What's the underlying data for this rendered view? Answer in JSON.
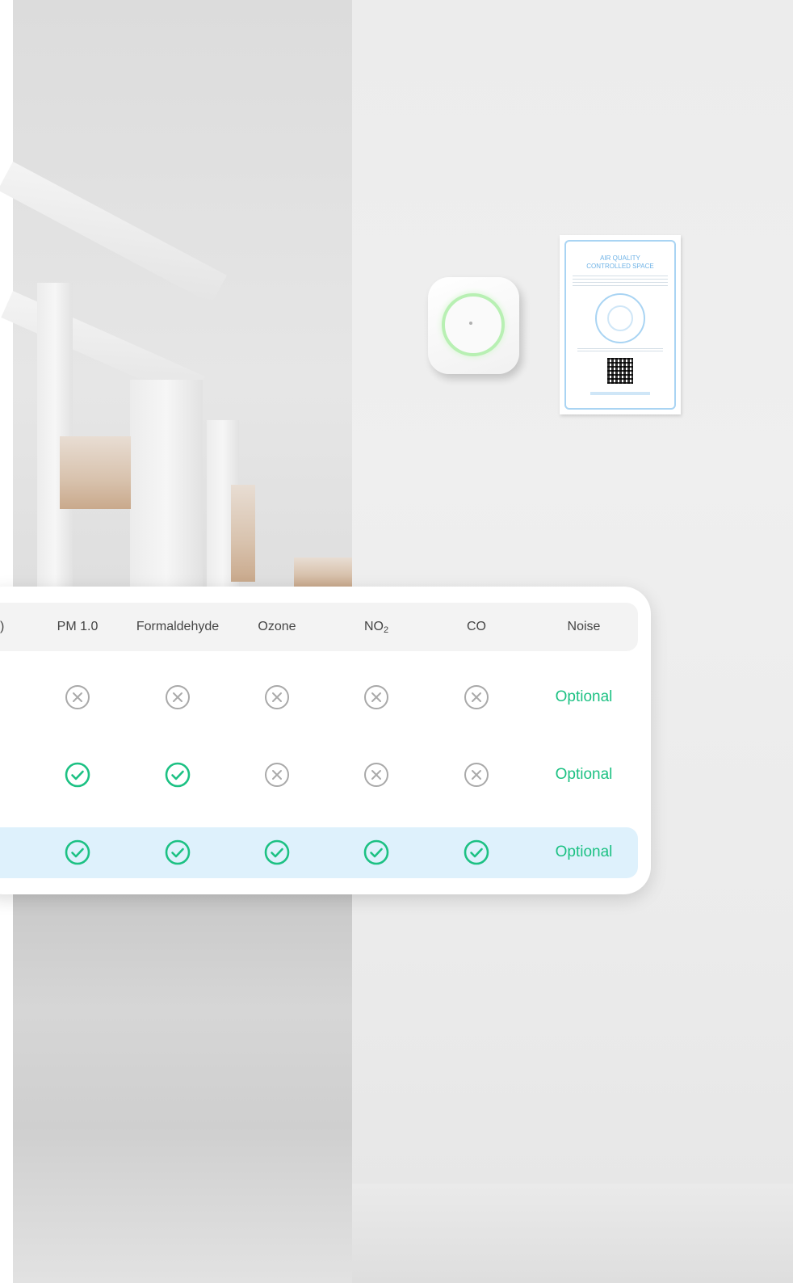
{
  "table": {
    "columns": [
      {
        "label": "PM 1.0"
      },
      {
        "label": "Formaldehyde"
      },
      {
        "label": "Ozone"
      },
      {
        "label": "NO",
        "sub": "2"
      },
      {
        "label": "CO"
      },
      {
        "label": "Noise"
      }
    ],
    "truncated_left_header": ")",
    "rows": [
      {
        "cells": [
          "cross",
          "cross",
          "cross",
          "cross",
          "cross"
        ],
        "noise": "Optional",
        "highlighted": false
      },
      {
        "cells": [
          "check",
          "check",
          "cross",
          "cross",
          "cross"
        ],
        "noise": "Optional",
        "highlighted": false
      },
      {
        "cells": [
          "check",
          "check",
          "check",
          "check",
          "check"
        ],
        "noise": "Optional",
        "highlighted": true
      }
    ]
  },
  "poster": {
    "title_line1": "AIR QUALITY",
    "title_line2": "CONTROLLED SPACE"
  },
  "colors": {
    "check": "#1cc183",
    "cross": "#a9a9a9",
    "highlight_row": "#def1fc",
    "header_row": "#f3f3f3"
  }
}
